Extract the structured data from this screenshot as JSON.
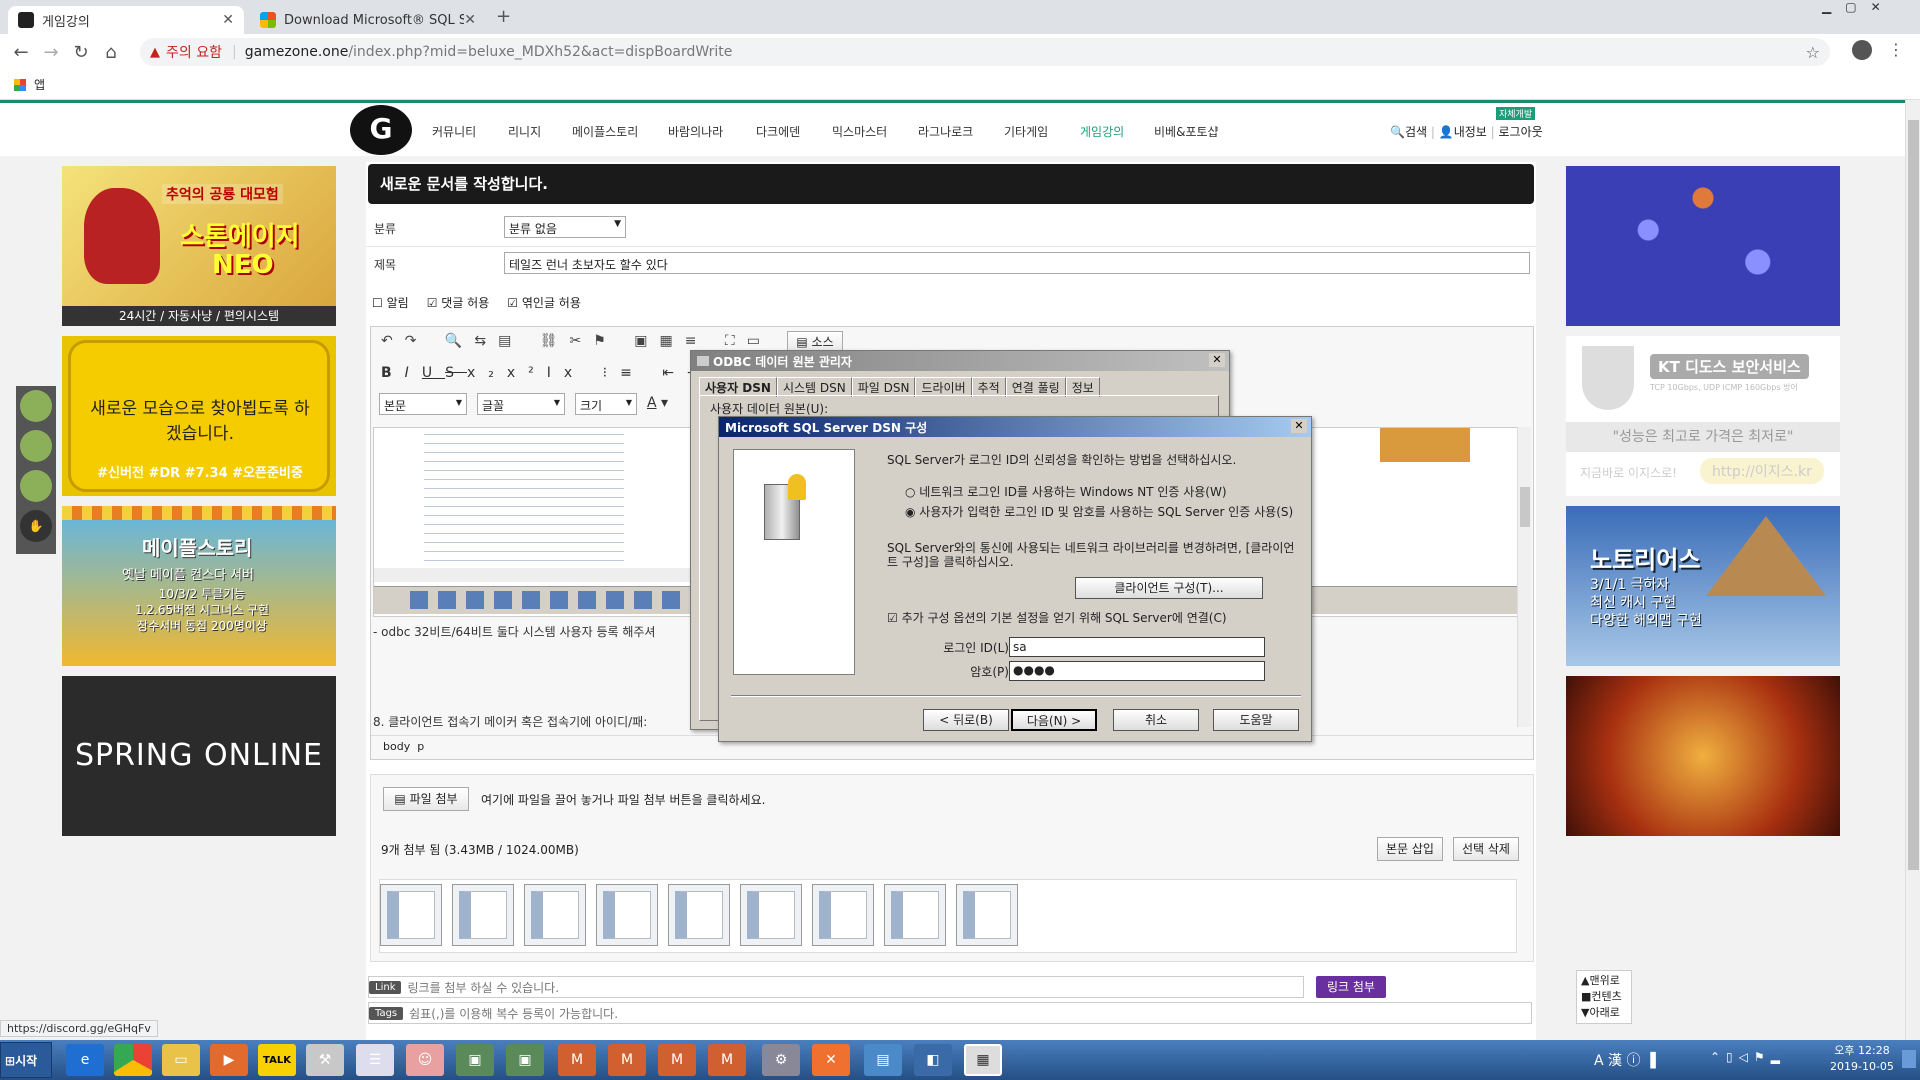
{
  "browser": {
    "tabs": [
      {
        "title": "게임강의",
        "active": true
      },
      {
        "title": "Download Microsoft® SQL Ser",
        "active": false
      }
    ],
    "security_label": "주의 요함",
    "url_host": "gamezone.one",
    "url_path": "/index.php?mid=beluxe_MDXh52&act=dispBoardWrite",
    "bookmarks_label": "앱",
    "status_url": "https://discord.gg/eGHqFv"
  },
  "site": {
    "menu": [
      "커뮤니티",
      "리니지",
      "메이플스토리",
      "바람의나라",
      "다크에덴",
      "믹스마스터",
      "라그나로크",
      "기타게임",
      "게임강의",
      "비베&포토샵"
    ],
    "active_menu": "게임강의",
    "badge": "자체개발",
    "right_links": [
      "검색",
      "내정보",
      "로그아웃"
    ]
  },
  "banners": {
    "left": [
      {
        "top": "추억의 공룡 대모험",
        "main": "스톤에이지",
        "sub": "NEO",
        "foot": "24시간 / 자동사냥 / 편의시스템"
      },
      {
        "main": "새로운 모습으로 찾아뵙도록 하겠습니다.",
        "foot": "#신버전 #DR #7.34 #오픈준비중"
      },
      {
        "main": "메이플스토리",
        "sub": "옛날 메이플 컨스다 서버",
        "lines": [
          "10/3/2 투클기능",
          "1.2.65버전 시그너스 구현",
          "장수서버 동접 200명이상"
        ]
      },
      {
        "main": "SPRING ONLINE"
      }
    ],
    "right": [
      {
        "main": ""
      },
      {
        "main": "KT 디도스 보안서비스",
        "sub": "TCP 10Gbps, UDP ICMP 160Gbps 방어",
        "quote": "\"성능은 최고로 가격은 최저로\"",
        "cta": "지금바로 이지스로!",
        "url": "http://이지스.kr"
      },
      {
        "main": "노토리어스",
        "lines": [
          "3/1/1 극하자",
          "최신 캐시 구현",
          "다양한 해외맵 구현"
        ]
      },
      {
        "main": ""
      }
    ]
  },
  "write": {
    "heading": "새로운 문서를 작성합니다.",
    "category_label": "분류",
    "category_value": "분류 없음",
    "title_label": "제목",
    "title_value": "테일즈 런너 초보자도 할수 있다",
    "options": [
      {
        "label": "알림",
        "checked": false
      },
      {
        "label": "댓글 허용",
        "checked": true
      },
      {
        "label": "엮인글 허용",
        "checked": true
      }
    ],
    "editor": {
      "source_label": "소스",
      "format_select": "본문",
      "font_select": "글꼴",
      "size_select": "크기",
      "body_text_1": "- odbc 32비트/64비트 둘다 시스템 사용자 등록 해주셔",
      "body_text_2": "8. 클라이언트 접속기 메이커 혹은 접속기에 아이디/패:",
      "path": [
        "body",
        "p"
      ]
    },
    "attach": {
      "button": "파일 첨부",
      "hint": "여기에 파일을 끌어 놓거나 파일 첨부 버튼을 클릭하세요.",
      "status": "9개 첨부 됨 (3.43MB / 1024.00MB)",
      "insert_button": "본문 삽입",
      "delete_button": "선택 삭제",
      "thumb_count": 9
    },
    "link": {
      "badge": "Link",
      "placeholder": "링크를 첨부 하실 수 있습니다.",
      "button": "링크 첨부"
    },
    "tags": {
      "badge": "Tags",
      "placeholder": "쉼표(,)를 이용해 복수 등록이 가능합니다."
    }
  },
  "quicknav": [
    "맨위로",
    "컨텐츠",
    "아래로"
  ],
  "odbc_dialog": {
    "title": "ODBC 데이터 원본 관리자",
    "tabs": [
      "사용자 DSN",
      "시스템 DSN",
      "파일 DSN",
      "드라이버",
      "추적",
      "연결 풀링",
      "정보"
    ],
    "peek_label": "사용자 데이터 원본(U):"
  },
  "dsn_dialog": {
    "title": "Microsoft SQL Server DSN 구성",
    "question": "SQL Server가 로그인 ID의 신뢰성을 확인하는 방법을 선택하십시오.",
    "radio_nt": "네트워크 로그인 ID를 사용하는 Windows NT 인증 사용(W)",
    "radio_sql": "사용자가 입력한 로그인 ID 및 암호를 사용하는 SQL Server 인증 사용(S)",
    "network_text": "SQL Server와의 통신에 사용되는 네트워크 라이브러리를 변경하려면, [클라이언트 구성]을 클릭하십시오.",
    "client_config_button": "클라이언트 구성(T)...",
    "connect_checkbox": "추가 구성 옵션의 기본 설정을 얻기 위해 SQL Server에 연결(C)",
    "login_label": "로그인 ID(L):",
    "login_value": "sa",
    "password_label": "암호(P):",
    "password_value": "●●●●",
    "back_button": "< 뒤로(B)",
    "next_button": "다음(N) >",
    "cancel_button": "취소",
    "help_button": "도움말"
  },
  "taskbar": {
    "start_label": "시작",
    "ime_label": "A 漢",
    "clock_time": "오후 12:28",
    "clock_date": "2019-10-05"
  }
}
